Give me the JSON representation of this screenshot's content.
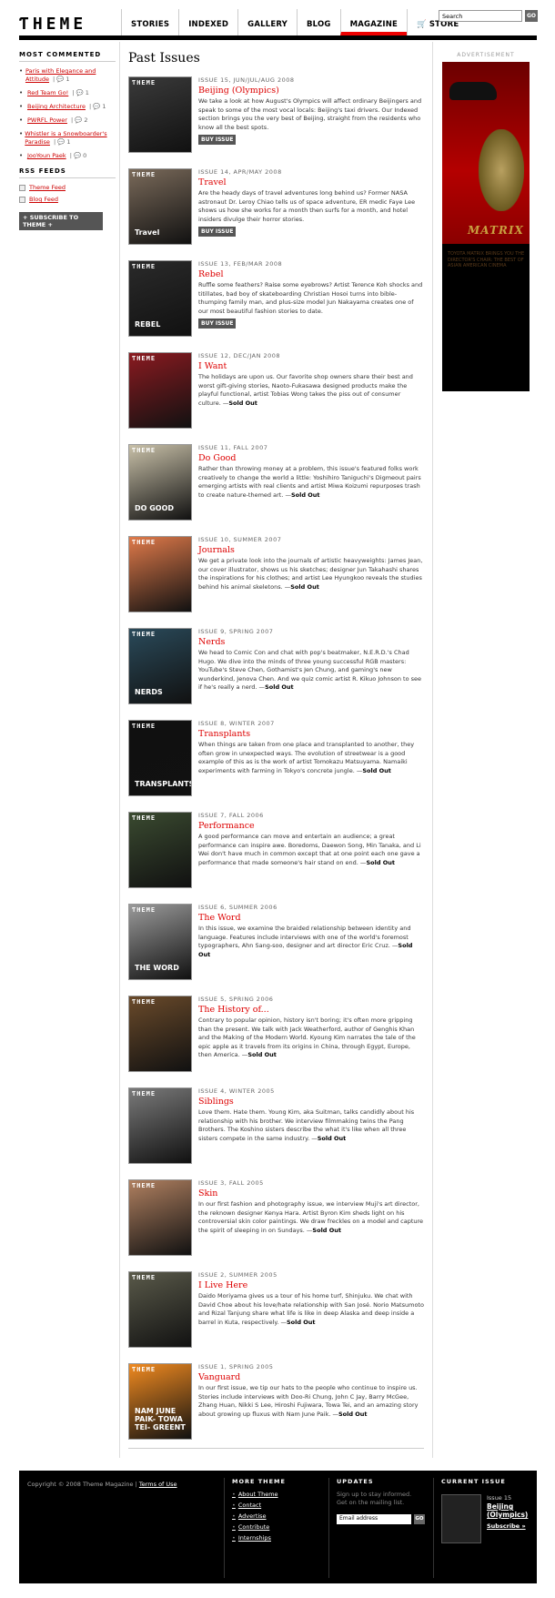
{
  "header": {
    "logo": "ƬHEME",
    "nav": [
      "Stories",
      "Indexed",
      "Gallery",
      "Blog",
      "Magazine",
      "Store"
    ],
    "search_value": "Search",
    "search_go": "GO"
  },
  "sidebar": {
    "most_commented_heading": "Most Commented",
    "most_commented": [
      {
        "title": "Paris with Elegance and Attitude",
        "count": "1"
      },
      {
        "title": "Red Team Go!",
        "count": "1"
      },
      {
        "title": "Beijing Architecture",
        "count": "1"
      },
      {
        "title": "PWRFL Power",
        "count": "2"
      },
      {
        "title": "Whistler is a Snowboarder's Paradise",
        "count": "1"
      },
      {
        "title": "JooYoun Paek",
        "count": "0"
      }
    ],
    "rss_heading": "RSS Feeds",
    "rss": [
      "Theme Feed",
      "Blog Feed"
    ],
    "subscribe": "+ SUBSCRIBE TO THEME +"
  },
  "main": {
    "title": "Past Issues",
    "buy_label": "BUY ISSUE",
    "issues": [
      {
        "no": "Issue 15, Jun/Jul/Aug 2008",
        "title": "Beijing (Olympics)",
        "desc": "We take a look at how August's Olympics will affect ordinary Beijingers and speak to some of the most vocal locals: Beijing's taxi drivers. Our Indexed section brings you the very best of Beijing, straight from the residents who know all the best spots.",
        "buy": true,
        "sold": "",
        "cover": "#3a3a3a",
        "word": ""
      },
      {
        "no": "Issue 14, Apr/May 2008",
        "title": "Travel",
        "desc": "Are the heady days of travel adventures long behind us? Former NASA astronaut Dr. Leroy Chiao tells us of space adventure, ER medic Faye Lee shows us how she works for a month then surfs for a month, and hotel insiders divulge their horror stories.",
        "buy": true,
        "sold": "",
        "cover": "#7a6a5a",
        "word": "Travel"
      },
      {
        "no": "Issue 13, Feb/Mar 2008",
        "title": "Rebel",
        "desc": "Ruffle some feathers? Raise some eyebrows? Artist Terence Koh shocks and titillates, bad boy of skateboarding Christian Hosoi turns into bible-thumping family man, and plus-size model Jun Nakayama creates one of our most beautiful fashion stories to date.",
        "buy": true,
        "sold": "",
        "cover": "#2a2a2a",
        "word": "REBEL"
      },
      {
        "no": "Issue 12, Dec/Jan 2008",
        "title": "I Want",
        "desc": "The holidays are upon us. Our favorite shop owners share their best and worst gift-giving stories, Naoto-Fukasawa designed products make the playful functional, artist Tobias Wong takes the piss out of consumer culture.",
        "buy": false,
        "sold": "Sold Out",
        "cover": "#8a1a20",
        "word": ""
      },
      {
        "no": "Issue 11, Fall 2007",
        "title": "Do Good",
        "desc": "Rather than throwing money at a problem, this issue's featured folks work creatively to change the world a little: Yoshihiro Taniguchi's Digmeout pairs emerging artists with real clients and artist Miwa Koizumi repurposes trash to create nature-themed art.",
        "buy": false,
        "sold": "Sold Out",
        "cover": "#c8c0a8",
        "word": "DO GOOD"
      },
      {
        "no": "Issue 10, Summer 2007",
        "title": "Journals",
        "desc": "We get a private look into the journals of artistic heavyweights: James Jean, our cover illustrator, shows us his sketches; designer Jun Takahashi shares the inspirations for his clothes; and artist Lee Hyungkoo reveals the studies behind his animal skeletons.",
        "buy": false,
        "sold": "Sold Out",
        "cover": "#e07a4a",
        "word": ""
      },
      {
        "no": "Issue 9, Spring 2007",
        "title": "Nerds",
        "desc": "We head to Comic Con and chat with pop's beatmaker, N.E.R.D.'s Chad Hugo. We dive into the minds of three young successful RGB masters: YouTube's Steve Chen, Gothamist's Jen Chung, and gaming's new wunderkind, Jenova Chen. And we quiz comic artist R. Kikuo Johnson to see if he's really a nerd.",
        "buy": false,
        "sold": "Sold Out",
        "cover": "#2a4a5a",
        "word": "NERDS"
      },
      {
        "no": "Issue 8, Winter 2007",
        "title": "Transplants",
        "desc": "When things are taken from one place and transplanted to another, they often grow in unexpected ways. The evolution of streetwear is a good example of this as is the work of artist Tomokazu Matsuyama. Namaiki experiments with farming in Tokyo's concrete jungle.",
        "buy": false,
        "sold": "Sold Out",
        "cover": "#101010",
        "word": "TRANSPLANTS"
      },
      {
        "no": "Issue 7, Fall 2006",
        "title": "Performance",
        "desc": "A good performance can move and entertain an audience; a great performance can inspire awe. Boredoms, Daewon Song, Min Tanaka, and Li Wei don't have much in common except that at one point each one gave a performance that made someone's hair stand on end.",
        "buy": false,
        "sold": "Sold Out",
        "cover": "#3a4a30",
        "word": ""
      },
      {
        "no": "Issue 6, Summer 2006",
        "title": "The Word",
        "desc": "In this issue, we examine the braided relationship between identity and language. Features include interviews with one of the world's foremost typographers, Ahn Sang-soo, designer and art director Eric Cruz.",
        "buy": false,
        "sold": "Sold Out",
        "cover": "#9a9a9a",
        "word": "THE WORD"
      },
      {
        "no": "Issue 5, Spring 2006",
        "title": "The History of...",
        "desc": "Contrary to popular opinion, history isn't boring; it's often more gripping than the present. We talk with Jack Weatherford, author of Genghis Khan and the Making of the Modern World. Kyoung Kim narrates the tale of the epic apple as it travels from its origins in China, through Egypt, Europe, then America.",
        "buy": false,
        "sold": "Sold Out",
        "cover": "#6a4a2a",
        "word": ""
      },
      {
        "no": "Issue 4, Winter 2005",
        "title": "Siblings",
        "desc": "Love them. Hate them. Young Kim, aka Suitman, talks candidly about his relationship with his brother. We interview filmmaking twins the Pang Brothers. The Koshino sisters describe the what it's like when all three sisters compete in the same industry.",
        "buy": false,
        "sold": "Sold Out",
        "cover": "#7a7a7a",
        "word": ""
      },
      {
        "no": "Issue 3, Fall 2005",
        "title": "Skin",
        "desc": "In our first fashion and photography issue, we interview Muji's art director, the reknown designer Kenya Hara. Artist Byron Kim sheds light on his controversial skin color paintings. We draw freckles on a model and capture the spirit of sleeping in on Sundays.",
        "buy": false,
        "sold": "Sold Out",
        "cover": "#b08060",
        "word": ""
      },
      {
        "no": "Issue 2, Summer 2005",
        "title": "I Live Here",
        "desc": "Daido Moriyama gives us a tour of his home turf, Shinjuku. We chat with David Choe about his love/hate relationship with San José. Norio Matsumoto and Rizal Tanjung share what life is like in deep Alaska and deep inside a barrel in Kuta, respectively.",
        "buy": false,
        "sold": "Sold Out",
        "cover": "#5a5a4a",
        "word": ""
      },
      {
        "no": "Issue 1, Spring 2005",
        "title": "Vanguard",
        "desc": "In our first issue, we tip our hats to the people who continue to inspire us. Stories include interviews with Doo-Ri Chung, John C Jay, Barry McGee, Zhang Huan, Nikki S Lee, Hiroshi Fujiwara, Towa Tei, and an amazing story about growing up fluxus with Nam June Paik.",
        "buy": false,
        "sold": "Sold Out",
        "cover": "#f08a20",
        "word": "NAM JUNE PAIK- TOWA TEI- GREENT"
      }
    ]
  },
  "ad": {
    "label": "Advertisement",
    "brand": "MATRIX",
    "text": "Toyota Matrix brings you the director's chair: the best of Asian American cinema"
  },
  "footer": {
    "copyright": "Copyright © 2008 Theme Magazine |",
    "terms": "Terms of Use",
    "more_heading": "More Theme",
    "more_links": [
      "About Theme",
      "Contact",
      "Advertise",
      "Contribute",
      "Internships"
    ],
    "updates_heading": "Updates",
    "updates_text": "Sign up to stay informed. Get on the mailing list.",
    "email_placeholder": "Email address",
    "go": "GO",
    "current_heading": "Current Issue",
    "current_issue_no": "Issue 15",
    "current_title": "Beijing (Olympics)",
    "subscribe": "Subscribe »"
  }
}
